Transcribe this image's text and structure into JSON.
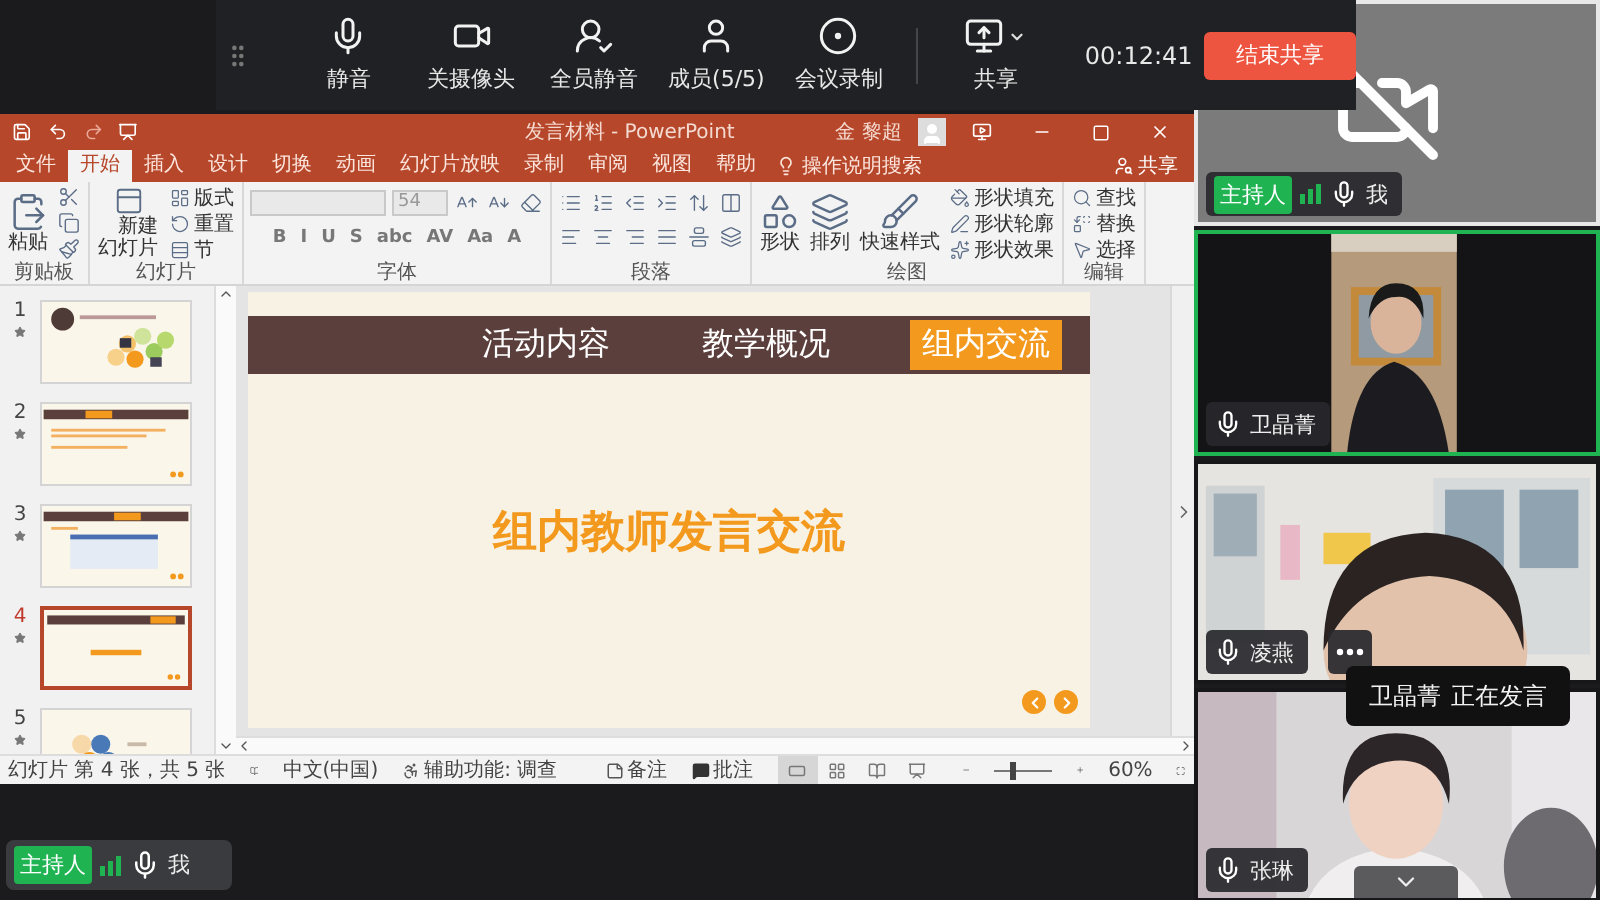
{
  "meeting_toolbar": {
    "buttons": [
      {
        "label": "静音",
        "dropdown": false
      },
      {
        "label": "关摄像头",
        "dropdown": false
      },
      {
        "label": "全员静音",
        "dropdown": false
      },
      {
        "label": "成员(5/5)",
        "dropdown": false
      },
      {
        "label": "会议录制",
        "dropdown": false
      },
      {
        "label": "共享",
        "dropdown": true
      }
    ],
    "timer": "00:12:41",
    "end_button": "结束共享"
  },
  "powerpoint": {
    "title": "发言材料 - PowerPoint",
    "account": "金 黎超",
    "share": "共享",
    "tell_me": "操作说明搜索",
    "tabs": [
      {
        "label": "文件",
        "selected": false
      },
      {
        "label": "开始",
        "selected": true
      },
      {
        "label": "插入",
        "selected": false
      },
      {
        "label": "设计",
        "selected": false
      },
      {
        "label": "切换",
        "selected": false
      },
      {
        "label": "动画",
        "selected": false
      },
      {
        "label": "幻灯片放映",
        "selected": false
      },
      {
        "label": "录制",
        "selected": false
      },
      {
        "label": "审阅",
        "selected": false
      },
      {
        "label": "视图",
        "selected": false
      },
      {
        "label": "帮助",
        "selected": false
      }
    ],
    "ribbon": [
      {
        "label": "剪贴板",
        "kind": "columns",
        "lines": [
          [
            {
              "kind": "large",
              "label": "粘贴"
            }
          ],
          [
            {
              "kind": "icon"
            },
            {
              "kind": "icon"
            },
            {
              "kind": "icon"
            }
          ]
        ]
      },
      {
        "label": "幻灯片",
        "kind": "columns",
        "lines": [
          [
            {
              "kind": "large",
              "label": "新建幻灯片"
            }
          ],
          [
            {
              "kind": "small",
              "label": "版式"
            },
            {
              "kind": "small",
              "label": "重置"
            },
            {
              "kind": "small",
              "label": "节"
            }
          ]
        ]
      },
      {
        "label": "字体",
        "kind": "rows",
        "lines": [
          [
            {
              "kind": "field"
            },
            {
              "kind": "field",
              "value": "54"
            },
            {
              "kind": "icon"
            },
            {
              "kind": "icon"
            },
            {
              "kind": "icon"
            }
          ],
          [
            {
              "kind": "glyph",
              "text": "B"
            },
            {
              "kind": "glyph",
              "text": "I"
            },
            {
              "kind": "glyph",
              "text": "U"
            },
            {
              "kind": "glyph",
              "text": "S"
            },
            {
              "kind": "glyph",
              "text": "abc"
            },
            {
              "kind": "glyph",
              "text": "AV"
            },
            {
              "kind": "glyph",
              "text": "Aa"
            },
            {
              "kind": "glyph",
              "text": "A"
            }
          ]
        ]
      },
      {
        "label": "段落",
        "kind": "rows",
        "lines": [
          [
            {
              "kind": "icon"
            },
            {
              "kind": "icon"
            },
            {
              "kind": "icon"
            },
            {
              "kind": "icon"
            },
            {
              "kind": "icon"
            },
            {
              "kind": "icon"
            }
          ],
          [
            {
              "kind": "icon"
            },
            {
              "kind": "icon"
            },
            {
              "kind": "icon"
            },
            {
              "kind": "icon"
            },
            {
              "kind": "icon"
            },
            {
              "kind": "icon"
            }
          ]
        ]
      },
      {
        "label": "绘图",
        "kind": "columns",
        "lines": [
          [
            {
              "kind": "large",
              "label": "形状"
            }
          ],
          [
            {
              "kind": "large",
              "label": "排列"
            }
          ],
          [
            {
              "kind": "large",
              "label": "快速样式"
            }
          ],
          [
            {
              "kind": "small",
              "label": "形状填充"
            },
            {
              "kind": "small",
              "label": "形状轮廓"
            },
            {
              "kind": "small",
              "label": "形状效果"
            }
          ]
        ]
      },
      {
        "label": "编辑",
        "kind": "columns",
        "lines": [
          [
            {
              "kind": "small",
              "label": "查找"
            },
            {
              "kind": "small",
              "label": "替换"
            },
            {
              "kind": "small",
              "label": "选择"
            }
          ]
        ]
      }
    ],
    "thumbnails": [
      {
        "number": "1",
        "kind": "cover",
        "selected": false
      },
      {
        "number": "2",
        "kind": "text",
        "selected": false
      },
      {
        "number": "3",
        "kind": "table",
        "selected": false
      },
      {
        "number": "4",
        "kind": "title",
        "selected": true
      },
      {
        "number": "5",
        "kind": "closing",
        "selected": false
      }
    ],
    "slide": {
      "tabs": [
        {
          "label": "活动内容",
          "selected": false
        },
        {
          "label": "教学概况",
          "selected": false
        },
        {
          "label": "组内交流",
          "selected": true
        }
      ],
      "title": "组内教师发言交流"
    },
    "status_bar": {
      "slide_count": "幻灯片 第 4 张，共 5 张",
      "language": "中文(中国)",
      "accessibility": "辅助功能: 调查",
      "notes": "备注",
      "comments": "批注",
      "zoom": "60%",
      "zoom_slider": {
        "level": 0.3
      }
    }
  },
  "participants": [
    {
      "name": "我",
      "badge": "主持人",
      "camera_on": false,
      "speaking": false,
      "more_button": false
    },
    {
      "name": "卫晶菁",
      "camera_on": true,
      "speaking": true,
      "more_button": false
    },
    {
      "name": "凌燕",
      "camera_on": true,
      "speaking": false,
      "more_button": true
    },
    {
      "name": "张琳",
      "camera_on": true,
      "speaking": false,
      "more_button": false
    }
  ],
  "speaker_tooltip": {
    "name": "卫晶菁",
    "status": "正在发言"
  },
  "self_bar": {
    "badge": "主持人",
    "name": "我"
  }
}
